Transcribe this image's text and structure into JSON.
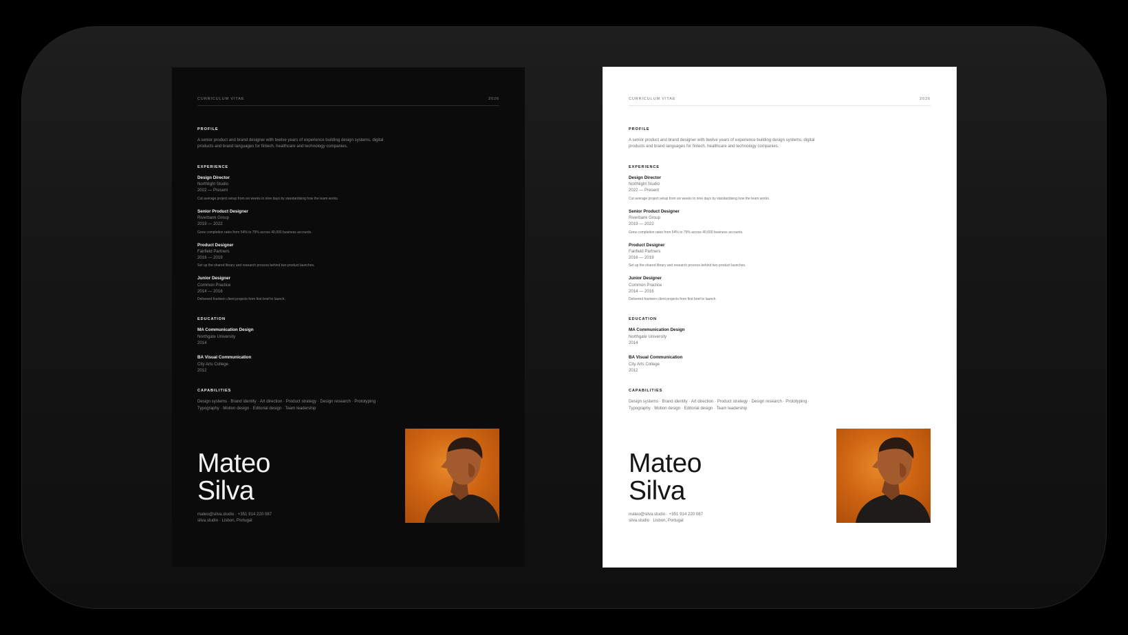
{
  "cv": {
    "header_label": "CURRICULUM VITAE",
    "year": "2026",
    "profile_title": "PROFILE",
    "profile_text": "A senior product and brand designer with twelve years of experience building design systems, digital products and brand languages for fintech, healthcare and technology companies.",
    "experience_title": "EXPERIENCE",
    "experience": [
      {
        "title": "Design Director",
        "company": "Northlight Studio",
        "period": "2022 — Present",
        "desc": "Cut average project setup from six weeks to nine days by standardising how the team works."
      },
      {
        "title": "Senior Product Designer",
        "company": "Riverbank Group",
        "period": "2019 — 2022",
        "desc": "Grew completion rates from 54% to 79% across 40,000 business accounts."
      },
      {
        "title": "Product Designer",
        "company": "Fairfield Partners",
        "period": "2016 — 2019",
        "desc": "Set up the shared library and research process behind two product launches."
      },
      {
        "title": "Junior Designer",
        "company": "Common Practice",
        "period": "2014 — 2016",
        "desc": "Delivered fourteen client projects from first brief to launch."
      }
    ],
    "education_title": "EDUCATION",
    "education": [
      {
        "degree": "MA Communication Design",
        "school": "Northgate University",
        "year": "2014"
      },
      {
        "degree": "BA Visual Communication",
        "school": "City Arts College",
        "year": "2012"
      }
    ],
    "capabilities_title": "CAPABILITIES",
    "capabilities": "Design systems · Brand identity · Art direction · Product strategy · Design research · Prototyping · Typography · Motion design · Editorial design · Team leadership",
    "first_name": "Mateo",
    "last_name": "Silva",
    "contact_line1": "mateo@silva.studio · +351 914 220 087",
    "contact_line2": "silva.studio · Lisbon, Portugal",
    "photo_icon": "portrait-photo"
  },
  "colors": {
    "dark_page": "#0b0b0b",
    "light_page": "#ffffff",
    "photo_orange": "#cf6512"
  }
}
